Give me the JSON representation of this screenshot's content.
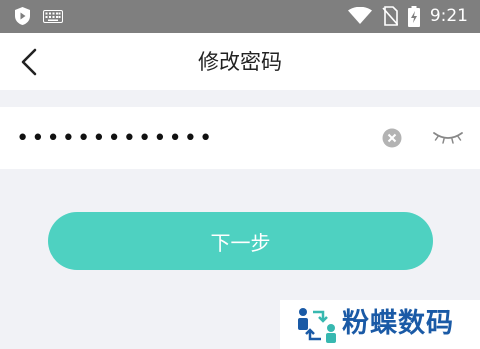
{
  "status_bar": {
    "time": "9:21",
    "icons": [
      "shield-icon",
      "keyboard-icon",
      "wifi-icon",
      "no-sim-icon",
      "battery-charging-icon"
    ]
  },
  "header": {
    "title": "修改密码",
    "back_icon": "chevron-left-icon"
  },
  "password": {
    "value": "•••••••••••••",
    "clear_icon": "clear-circle-icon",
    "visibility_icon": "eye-closed-icon"
  },
  "actions": {
    "next_label": "下一步"
  },
  "watermark": {
    "text": "粉蝶数码"
  },
  "colors": {
    "accent": "#4ed1c1",
    "status_bar": "#7f7f7f",
    "background": "#f1f2f6",
    "watermark": "#1a5aa6"
  }
}
